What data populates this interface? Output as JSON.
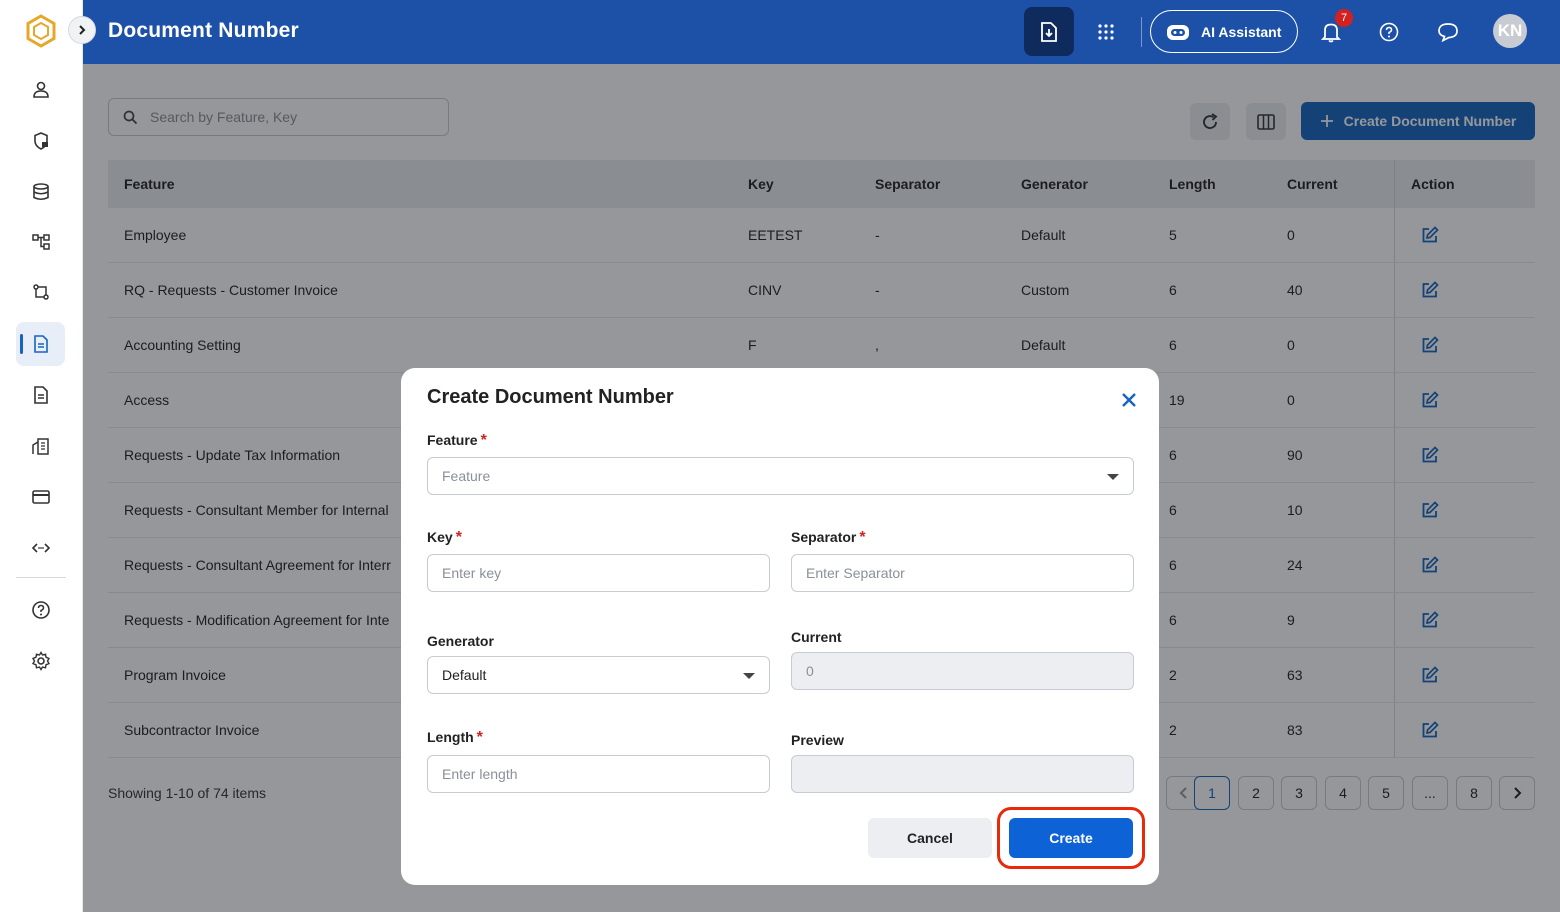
{
  "header": {
    "title": "Document Number",
    "ai_label": "AI Assistant",
    "notification_count": "7",
    "avatar_initials": "KN"
  },
  "toolbar": {
    "search_placeholder": "Search by Feature, Key",
    "create_label": "Create Document Number"
  },
  "table": {
    "columns": [
      "Feature",
      "Key",
      "Separator",
      "Generator",
      "Length",
      "Current",
      "Action"
    ],
    "rows": [
      {
        "feature": "Employee",
        "key": "EETEST",
        "separator": "-",
        "generator": "Default",
        "length": "5",
        "current": "0"
      },
      {
        "feature": "RQ - Requests - Customer Invoice",
        "key": "CINV",
        "separator": "-",
        "generator": "Custom",
        "length": "6",
        "current": "40"
      },
      {
        "feature": "Accounting Setting",
        "key": "F",
        "separator": ",",
        "generator": "Default",
        "length": "6",
        "current": "0"
      },
      {
        "feature": "Access",
        "key": "",
        "separator": "",
        "generator": "",
        "length": "19",
        "current": "0"
      },
      {
        "feature": "Requests - Update Tax Information",
        "key": "",
        "separator": "",
        "generator": "",
        "length": "6",
        "current": "90"
      },
      {
        "feature": "Requests - Consultant Member for Internal",
        "key": "",
        "separator": "",
        "generator": "",
        "length": "6",
        "current": "10"
      },
      {
        "feature": "Requests - Consultant Agreement for Interr",
        "key": "",
        "separator": "",
        "generator": "",
        "length": "6",
        "current": "24"
      },
      {
        "feature": "Requests - Modification Agreement for Inte",
        "key": "",
        "separator": "",
        "generator": "",
        "length": "6",
        "current": "9"
      },
      {
        "feature": "Program Invoice",
        "key": "",
        "separator": "",
        "generator": "",
        "length": "2",
        "current": "63"
      },
      {
        "feature": "Subcontractor Invoice",
        "key": "",
        "separator": "",
        "generator": "",
        "length": "2",
        "current": "83"
      }
    ]
  },
  "footer": {
    "showing": "Showing 1-10 of 74 items",
    "pages": [
      "1",
      "2",
      "3",
      "4",
      "5",
      "...",
      "8"
    ]
  },
  "modal": {
    "title": "Create Document Number",
    "feature_label": "Feature",
    "feature_placeholder": "Feature",
    "key_label": "Key",
    "key_placeholder": "Enter key",
    "separator_label": "Separator",
    "separator_placeholder": "Enter Separator",
    "generator_label": "Generator",
    "generator_value": "Default",
    "current_label": "Current",
    "current_value": "0",
    "length_label": "Length",
    "length_placeholder": "Enter length",
    "preview_label": "Preview",
    "preview_value": "",
    "cancel_label": "Cancel",
    "create_label": "Create",
    "required_mark": "*"
  },
  "colors": {
    "header_bg": "#1d51a8",
    "primary": "#1565c0",
    "highlight": "#e8290b"
  }
}
